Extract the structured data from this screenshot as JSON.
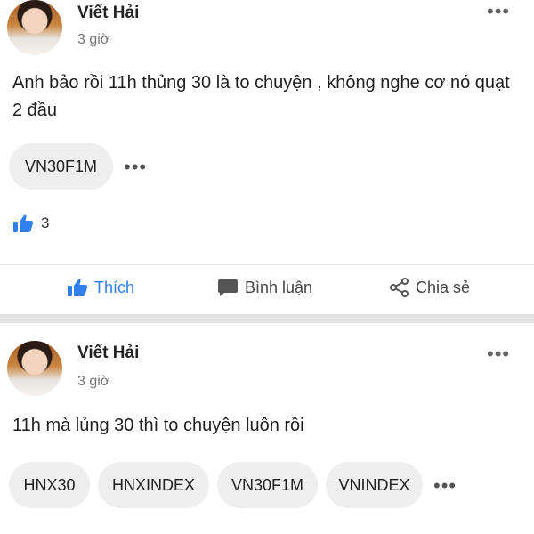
{
  "posts": [
    {
      "author": "Viết Hải",
      "time": "3 giờ",
      "text": "Anh bảo rồi 11h thủng 30 là to chuyện , không nghe cơ nó quạt 2 đầu",
      "tags": [
        "VN30F1M"
      ],
      "like_count": "3"
    },
    {
      "author": "Viết Hải",
      "time": "3 giờ",
      "text": "11h mà lủng 30 thì to chuyện luôn rồi",
      "tags": [
        "HNX30",
        "HNXINDEX",
        "VN30F1M",
        "VNINDEX"
      ]
    }
  ],
  "actions": {
    "like": "Thích",
    "comment": "Bình luận",
    "share": "Chia sẻ"
  },
  "more_glyph": "•••",
  "colors": {
    "accent": "#2f80ed",
    "muted": "#777777",
    "tag_bg": "#efefef",
    "divider": "#e3e3e3"
  },
  "icons": [
    "thumbs-up-icon",
    "comment-icon",
    "share-icon",
    "more-icon"
  ]
}
